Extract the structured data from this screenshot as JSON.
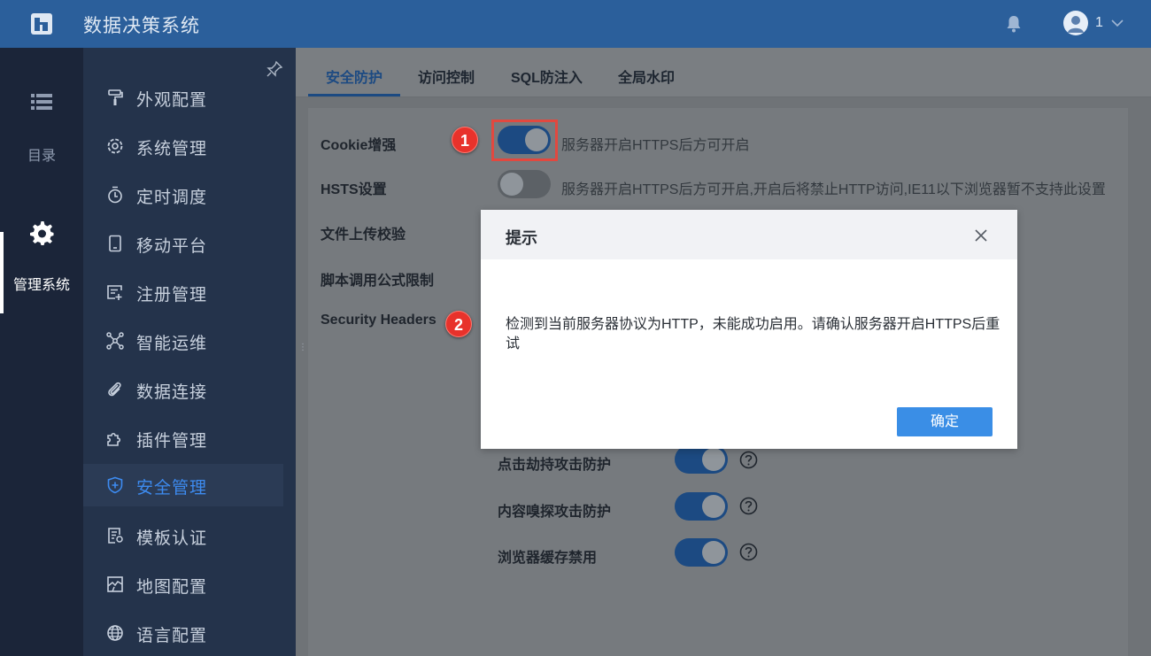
{
  "header": {
    "app_title": "数据决策系统",
    "user_name": "1"
  },
  "rail": {
    "items": [
      {
        "label": "目录",
        "icon": "list-icon"
      },
      {
        "label": "管理系统",
        "icon": "gear-icon"
      }
    ]
  },
  "sidebar": {
    "items": [
      {
        "label": "外观配置",
        "icon": "paint-roller-icon"
      },
      {
        "label": "系统管理",
        "icon": "gear-icon"
      },
      {
        "label": "定时调度",
        "icon": "timer-icon"
      },
      {
        "label": "移动平台",
        "icon": "mobile-icon"
      },
      {
        "label": "注册管理",
        "icon": "register-icon"
      },
      {
        "label": "智能运维",
        "icon": "network-icon"
      },
      {
        "label": "数据连接",
        "icon": "link-icon"
      },
      {
        "label": "插件管理",
        "icon": "puzzle-icon"
      },
      {
        "label": "安全管理",
        "icon": "shield-icon"
      },
      {
        "label": "模板认证",
        "icon": "certificate-icon"
      },
      {
        "label": "地图配置",
        "icon": "map-icon"
      },
      {
        "label": "语言配置",
        "icon": "globe-icon"
      }
    ],
    "active_index": 8
  },
  "tabs": [
    {
      "label": "安全防护"
    },
    {
      "label": "访问控制"
    },
    {
      "label": "SQL防注入"
    },
    {
      "label": "全局水印"
    }
  ],
  "settings": {
    "cookie": {
      "label": "Cookie增强",
      "desc": "服务器开启HTTPS后方可开启",
      "on": true
    },
    "hsts": {
      "label": "HSTS设置",
      "desc": "服务器开启HTTPS后方可开启,开启后将禁止HTTP访问,IE11以下浏览器暂不支持此设置",
      "on": false
    },
    "upload": {
      "label": "文件上传校验"
    },
    "script": {
      "label": "脚本调用公式限制"
    },
    "security_headers": {
      "label": "Security Headers"
    },
    "sub": [
      {
        "label": "点击劫持攻击防护",
        "on": true
      },
      {
        "label": "内容嗅探攻击防护",
        "on": true
      },
      {
        "label": "浏览器缓存禁用",
        "on": true
      }
    ]
  },
  "annotations": {
    "badge1": "1",
    "badge2": "2"
  },
  "dialog": {
    "title": "提示",
    "message": "检测到当前服务器协议为HTTP，未能成功启用。请确认服务器开启HTTPS后重试",
    "ok_label": "确定"
  },
  "colors": {
    "topbar": "#2b5f9b",
    "accent": "#3d8bf0",
    "toggle_on": "#1c4a82",
    "badge": "#e8322b",
    "button": "#3a8ee6"
  }
}
